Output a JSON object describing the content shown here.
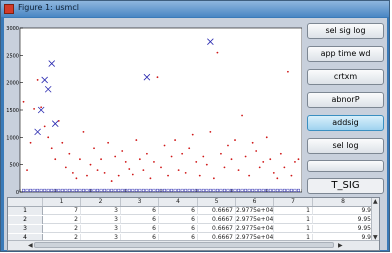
{
  "window": {
    "title": "Figure 1: usmcl"
  },
  "buttons": [
    {
      "id": "sel-sig-log",
      "label": "sel sig log"
    },
    {
      "id": "app-time-wd",
      "label": "app time wd"
    },
    {
      "id": "crtxm",
      "label": "crtxm"
    },
    {
      "id": "abnorp",
      "label": "abnorP"
    },
    {
      "id": "addsig",
      "label": "addsig",
      "active": true
    },
    {
      "id": "sel-log",
      "label": "sel log"
    }
  ],
  "sig_label": "T_SIG",
  "colors": {
    "window_blue": "#3a7ab8",
    "red_points": "#d01818",
    "blue_markers": "#2a2ab0",
    "active_button": "#9fd2ef"
  },
  "chart_data": {
    "type": "scatter",
    "xlim": [
      0,
      80
    ],
    "ylim": [
      0,
      3000
    ],
    "x_ticks": [
      "0",
      "10",
      "20",
      "30",
      "40",
      "50",
      "60",
      "70",
      "80"
    ],
    "y_ticks": [
      "0",
      "500",
      "1000",
      "1500",
      "2000",
      "2500",
      "3000"
    ],
    "series": [
      {
        "marker": "dot",
        "color": "#d01818",
        "x": [
          1,
          2,
          3,
          4,
          5,
          6,
          7,
          8,
          9,
          10,
          11,
          12,
          13,
          14,
          15,
          16,
          17,
          18,
          19,
          20,
          21,
          22,
          23,
          24,
          25,
          26,
          27,
          28,
          29,
          30,
          31,
          32,
          33,
          34,
          35,
          36,
          37,
          38,
          39,
          40,
          41,
          42,
          43,
          44,
          45,
          46,
          47,
          48,
          49,
          50,
          51,
          52,
          53,
          54,
          55,
          56,
          57,
          58,
          59,
          60,
          61,
          62,
          63,
          64,
          65,
          66,
          67,
          68,
          69,
          70,
          71,
          72,
          73,
          74,
          75,
          76,
          77,
          78,
          79
        ],
        "y": [
          1650,
          400,
          900,
          1520,
          2050,
          1550,
          1200,
          1000,
          800,
          600,
          1300,
          900,
          450,
          700,
          350,
          250,
          600,
          1100,
          300,
          500,
          800,
          400,
          600,
          350,
          900,
          200,
          650,
          300,
          750,
          550,
          420,
          320,
          950,
          600,
          400,
          700,
          250,
          550,
          2100,
          450,
          850,
          300,
          650,
          950,
          400,
          700,
          350,
          800,
          1050,
          550,
          300,
          650,
          500,
          1100,
          250,
          2550,
          700,
          450,
          850,
          600,
          950,
          400,
          1400,
          650,
          300,
          900,
          750,
          450,
          550,
          1000,
          600,
          350,
          250,
          700,
          450,
          2200,
          300,
          550,
          600
        ]
      },
      {
        "marker": "x",
        "color": "#2a2ab0",
        "x": [
          5,
          6,
          7,
          8,
          9,
          10,
          36,
          54
        ],
        "y": [
          1100,
          1500,
          2050,
          1880,
          2350,
          1250,
          2100,
          2750
        ]
      },
      {
        "marker": "square",
        "color": "#2a2ab0",
        "x": [
          1,
          2,
          3,
          4,
          5,
          6,
          7,
          8,
          9,
          10,
          11,
          12,
          13,
          14,
          15,
          16,
          17,
          18,
          19,
          20,
          21,
          22,
          23,
          24,
          25,
          26,
          27,
          28,
          29,
          30,
          31,
          32,
          33,
          34,
          35,
          36,
          37,
          38,
          39,
          40,
          41,
          42,
          43,
          44,
          45,
          46,
          47,
          48,
          49,
          50,
          51,
          52,
          53,
          54,
          55,
          56,
          57,
          58,
          59,
          60,
          61,
          62,
          63,
          64,
          65,
          66,
          67,
          68,
          69,
          70,
          71,
          72,
          73,
          74,
          75,
          76,
          77,
          78,
          79
        ],
        "y": [
          30,
          30,
          30,
          30,
          30,
          30,
          30,
          30,
          30,
          30,
          30,
          30,
          30,
          30,
          30,
          30,
          30,
          30,
          30,
          30,
          30,
          30,
          30,
          30,
          30,
          30,
          30,
          30,
          30,
          30,
          30,
          30,
          30,
          30,
          30,
          30,
          30,
          30,
          30,
          30,
          30,
          30,
          30,
          30,
          30,
          30,
          30,
          30,
          30,
          30,
          30,
          30,
          30,
          30,
          30,
          30,
          30,
          30,
          30,
          30,
          30,
          30,
          30,
          30,
          30,
          30,
          30,
          30,
          30,
          30,
          30,
          30,
          30,
          30,
          30,
          30,
          30,
          30,
          30
        ]
      }
    ]
  },
  "table": {
    "columns": [
      "",
      "1",
      "2",
      "3",
      "4",
      "5",
      "6",
      "7",
      "8"
    ],
    "rows": [
      {
        "head": "1",
        "cells": [
          "7",
          "3",
          "6",
          "6",
          "0.6667",
          "2.9775e+04",
          "1",
          "9.9"
        ]
      },
      {
        "head": "2",
        "cells": [
          "2",
          "3",
          "6",
          "6",
          "0.6667",
          "2.9775e+04",
          "1",
          "9.95"
        ]
      },
      {
        "head": "3",
        "cells": [
          "2",
          "3",
          "6",
          "6",
          "0.6667",
          "2.9775e+04",
          "1",
          "9.95"
        ]
      },
      {
        "head": "4",
        "cells": [
          "2",
          "3",
          "6",
          "6",
          "0.6667",
          "2.9775e+04",
          "1",
          "9.9"
        ]
      }
    ]
  }
}
